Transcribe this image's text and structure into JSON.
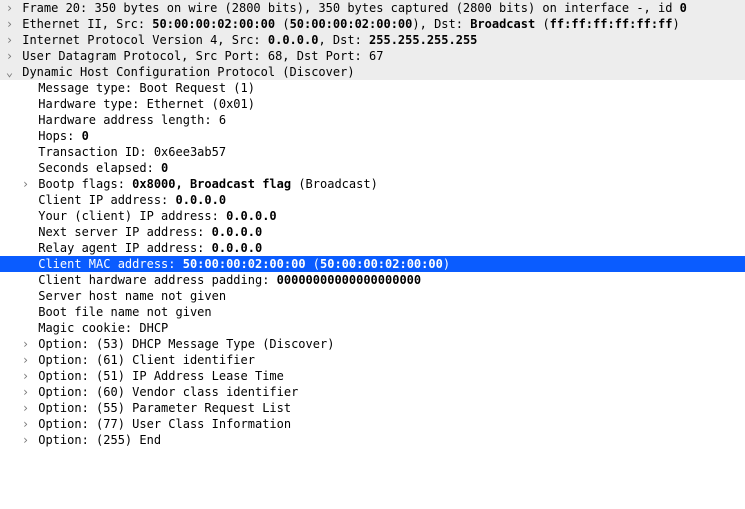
{
  "shaded_rows": [
    {
      "expanded": false,
      "text_html": "Frame 20: 350 bytes on wire (2800 bits), 350 bytes captured (2800 bits) on interface -, id <b>0</b>"
    },
    {
      "expanded": false,
      "text_html": "Ethernet II, Src: <b>50:00:00:02:00:00</b> (<b>50:00:00:02:00:00</b>), Dst: <b>Broadcast</b> (<b>ff:ff:ff:ff:ff:ff</b>)"
    },
    {
      "expanded": false,
      "text_html": "Internet Protocol Version 4, Src: <b>0.0.0.0</b>, Dst: <b>255.255.255.255</b>"
    },
    {
      "expanded": false,
      "text_html": "User Datagram Protocol, Src Port: 68, Dst Port: 67"
    },
    {
      "expanded": true,
      "text_html": "Dynamic Host Configuration Protocol (Discover)"
    }
  ],
  "dhcp_rows": [
    {
      "toggle": "none",
      "selected": false,
      "text_html": "Message type: Boot Request (1)"
    },
    {
      "toggle": "none",
      "selected": false,
      "text_html": "Hardware type: Ethernet (0x01)"
    },
    {
      "toggle": "none",
      "selected": false,
      "text_html": "Hardware address length: 6"
    },
    {
      "toggle": "none",
      "selected": false,
      "text_html": "Hops: <b>0</b>"
    },
    {
      "toggle": "none",
      "selected": false,
      "text_html": "Transaction ID: 0x6ee3ab57"
    },
    {
      "toggle": "none",
      "selected": false,
      "text_html": "Seconds elapsed: <b>0</b>"
    },
    {
      "toggle": "collapsed",
      "selected": false,
      "text_html": "Bootp flags: <b>0x8000, Broadcast flag</b> (Broadcast)"
    },
    {
      "toggle": "none",
      "selected": false,
      "text_html": "Client IP address: <b>0.0.0.0</b>"
    },
    {
      "toggle": "none",
      "selected": false,
      "text_html": "Your (client) IP address: <b>0.0.0.0</b>"
    },
    {
      "toggle": "none",
      "selected": false,
      "text_html": "Next server IP address: <b>0.0.0.0</b>"
    },
    {
      "toggle": "none",
      "selected": false,
      "text_html": "Relay agent IP address: <b>0.0.0.0</b>"
    },
    {
      "toggle": "none",
      "selected": true,
      "text_html": "Client MAC address: <b>50:00:00:02:00:00</b> (<b>50:00:00:02:00:00</b>)"
    },
    {
      "toggle": "none",
      "selected": false,
      "text_html": "Client hardware address padding: <b>00000000000000000000</b>"
    },
    {
      "toggle": "none",
      "selected": false,
      "text_html": "Server host name not given"
    },
    {
      "toggle": "none",
      "selected": false,
      "text_html": "Boot file name not given"
    },
    {
      "toggle": "none",
      "selected": false,
      "text_html": "Magic cookie: DHCP"
    },
    {
      "toggle": "collapsed",
      "selected": false,
      "text_html": "Option: (53) DHCP Message Type (Discover)"
    },
    {
      "toggle": "collapsed",
      "selected": false,
      "text_html": "Option: (61) Client identifier"
    },
    {
      "toggle": "collapsed",
      "selected": false,
      "text_html": "Option: (51) IP Address Lease Time"
    },
    {
      "toggle": "collapsed",
      "selected": false,
      "text_html": "Option: (60) Vendor class identifier"
    },
    {
      "toggle": "collapsed",
      "selected": false,
      "text_html": "Option: (55) Parameter Request List"
    },
    {
      "toggle": "collapsed",
      "selected": false,
      "text_html": "Option: (77) User Class Information"
    },
    {
      "toggle": "collapsed",
      "selected": false,
      "text_html": "Option: (255) End"
    }
  ],
  "glyphs": {
    "collapsed": "›",
    "expanded": "⌄",
    "none": " "
  }
}
